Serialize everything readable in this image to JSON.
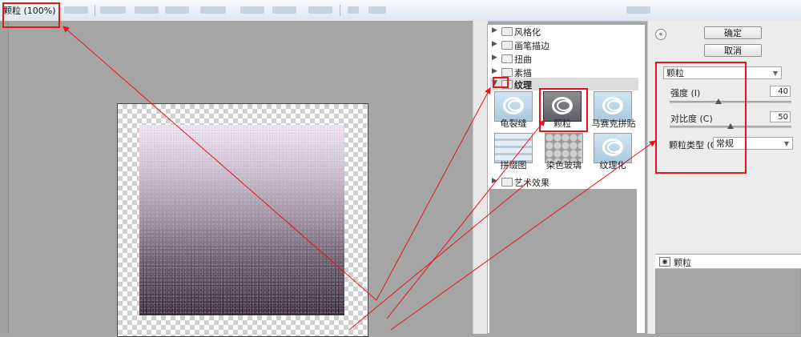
{
  "window": {
    "title": "颗粒 (100%)"
  },
  "filter_panel": {
    "categories": [
      {
        "label": "风格化",
        "expanded": false
      },
      {
        "label": "画笔描边",
        "expanded": false
      },
      {
        "label": "扭曲",
        "expanded": false
      },
      {
        "label": "素描",
        "expanded": false
      },
      {
        "label": "纹理",
        "expanded": true
      },
      {
        "label": "艺术效果",
        "expanded": false
      }
    ],
    "texture_filters": [
      {
        "label": "龟裂缝"
      },
      {
        "label": "颗粒",
        "selected": true
      },
      {
        "label": "马赛克拼贴"
      },
      {
        "label": "拼缀图"
      },
      {
        "label": "染色玻璃"
      },
      {
        "label": "纹理化"
      }
    ]
  },
  "settings": {
    "ok_label": "确定",
    "cancel_label": "取消",
    "filter_select": "颗粒",
    "intensity": {
      "label": "强度 (I)",
      "value": "40",
      "fraction": 0.4
    },
    "contrast": {
      "label": "对比度 (C)",
      "value": "50",
      "fraction": 0.5
    },
    "grain_type": {
      "label": "颗粒类型 (G):",
      "value": "常规"
    }
  },
  "layers": {
    "effect_layer_label": "颗粒"
  },
  "annotation": {
    "color": "#e01818"
  }
}
